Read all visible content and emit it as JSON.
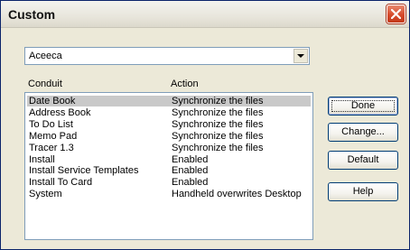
{
  "window": {
    "title": "Custom",
    "close_icon": "close-icon"
  },
  "selector": {
    "value": "Aceeca",
    "icon": "chevron-down-icon"
  },
  "columns": {
    "conduit": "Conduit",
    "action": "Action"
  },
  "rows": [
    {
      "conduit": "Date Book",
      "action": "Synchronize the files",
      "selected": true
    },
    {
      "conduit": "Address Book",
      "action": "Synchronize the files",
      "selected": false
    },
    {
      "conduit": "To Do List",
      "action": "Synchronize the files",
      "selected": false
    },
    {
      "conduit": "Memo Pad",
      "action": "Synchronize the files",
      "selected": false
    },
    {
      "conduit": "Tracer 1.3",
      "action": "Synchronize the files",
      "selected": false
    },
    {
      "conduit": "Install",
      "action": "Enabled",
      "selected": false
    },
    {
      "conduit": "Install Service Templates",
      "action": "Enabled",
      "selected": false
    },
    {
      "conduit": "Install To Card",
      "action": "Enabled",
      "selected": false
    },
    {
      "conduit": "System",
      "action": "Handheld overwrites Desktop",
      "selected": false
    }
  ],
  "buttons": {
    "done": "Done",
    "change": "Change...",
    "default": "Default",
    "help": "Help"
  },
  "colors": {
    "selection": "#c9c9c9",
    "close_button": "#d64a2b",
    "field_border": "#7f9db9"
  }
}
